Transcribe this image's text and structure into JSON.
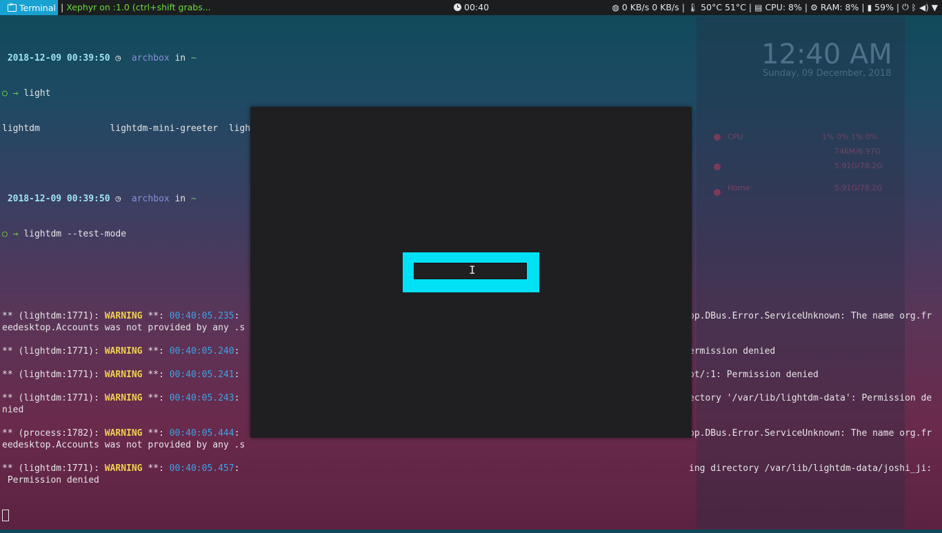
{
  "panel": {
    "terminal_label": "Terminal",
    "window_title": "Xephyr on :1.0 (ctrl+shift grabs...",
    "clock": "00:40",
    "network": "0 KB/s 0 KB/s |",
    "temps": "50°C  51°C |",
    "cpu": "CPU: 8% |",
    "ram": "RAM: 8% |",
    "battery": "59% |"
  },
  "terminal": {
    "prompt1_ts": "2018-12-09 00:39:50",
    "host": "archbox",
    "in_word": "in",
    "tilde": "~",
    "cmd1": "light",
    "completions": "lightdm             lightdm-mini-greeter  light-locker          light-locker-command",
    "prompt2_ts": "2018-12-09 00:39:50",
    "cmd2": "lightdm --test-mode",
    "warnings": [
      {
        "prefix": "** (lightdm:1771): ",
        "time": "00:40:05.235",
        "tail": "op.DBus.Error.ServiceUnknown: The name org.fr",
        "cont": "eedesktop.Accounts was not provided by any .s"
      },
      {
        "prefix": "** (lightdm:1771): ",
        "time": "00:40:05.240",
        "tail": "ermission denied",
        "cont": ""
      },
      {
        "prefix": "** (lightdm:1771): ",
        "time": "00:40:05.241",
        "tail": "ot/:1: Permission denied",
        "cont": ""
      },
      {
        "prefix": "** (lightdm:1771): ",
        "time": "00:40:05.243",
        "tail": "ectory '/var/lib/lightdm-data': Permission de",
        "cont": "nied"
      },
      {
        "prefix": "** (process:1782): ",
        "time": "00:40:05.444",
        "tail": "op.DBus.Error.ServiceUnknown: The name org.fr",
        "cont": "eedesktop.Accounts was not provided by any .s"
      },
      {
        "prefix": "** (lightdm:1771): ",
        "time": "00:40:05.457",
        "tail": "ing directory /var/lib/lightdm-data/joshi_ji:",
        "cont": " Permission denied"
      }
    ],
    "warn_word": "WARNING",
    "warn_stars": " **: "
  },
  "conky": {
    "time": "12:40 AM",
    "date": "Sunday, 09 December, 2018",
    "cpu_label": "CPU",
    "cpu_vals": "1% 0% 1% 0%",
    "mem_vals": "746M/6.97G",
    "disk1": "5.91G/78.2G",
    "home_label": "Home",
    "disk2": "5.91G/78.2G"
  },
  "xephyr": {
    "password_field": ""
  }
}
